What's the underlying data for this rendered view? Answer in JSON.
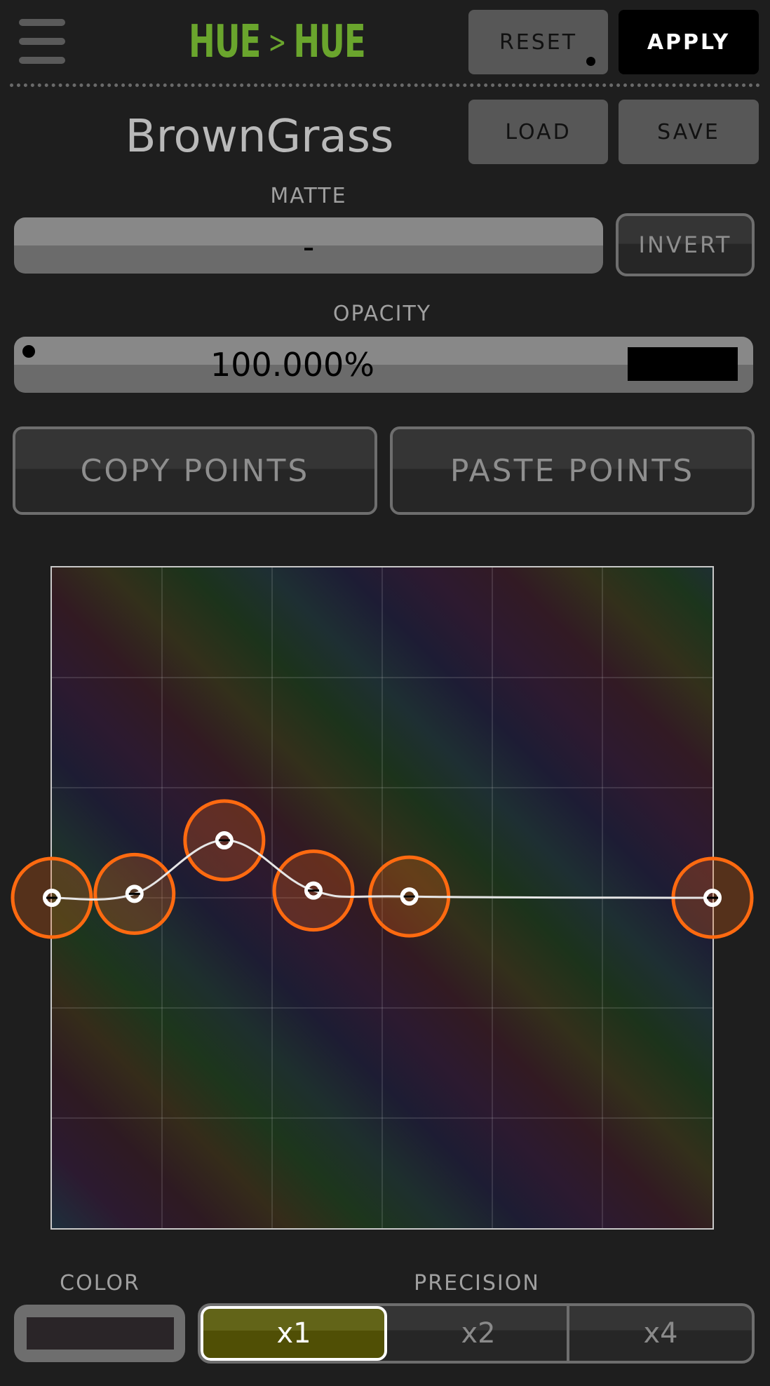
{
  "header": {
    "title_left": "HUE",
    "title_sep": ">",
    "title_right": "HUE",
    "reset_label": "RESET",
    "apply_label": "APPLY",
    "menu_icon": "hamburger-menu-icon"
  },
  "preset": {
    "name": "BrownGrass",
    "load_label": "LOAD",
    "save_label": "SAVE"
  },
  "matte": {
    "label": "MATTE",
    "value": "-",
    "invert_label": "INVERT"
  },
  "opacity": {
    "label": "OPACITY",
    "value": "100.000%",
    "level": 1.0
  },
  "points_actions": {
    "copy_label": "COPY POINTS",
    "paste_label": "PASTE POINTS"
  },
  "curve": {
    "control_points": [
      {
        "x": 0.0,
        "y": 0.5
      },
      {
        "x": 0.125,
        "y": 0.506
      },
      {
        "x": 0.261,
        "y": 0.587
      },
      {
        "x": 0.396,
        "y": 0.511
      },
      {
        "x": 0.541,
        "y": 0.502
      },
      {
        "x": 1.0,
        "y": 0.5
      }
    ],
    "handle_color": "#ff6a10",
    "line_color": "#e6e6e6"
  },
  "color": {
    "label": "COLOR",
    "swatch": "#2a2528"
  },
  "precision": {
    "label": "PRECISION",
    "options": [
      "x1",
      "x2",
      "x4"
    ],
    "selected": "x1"
  }
}
